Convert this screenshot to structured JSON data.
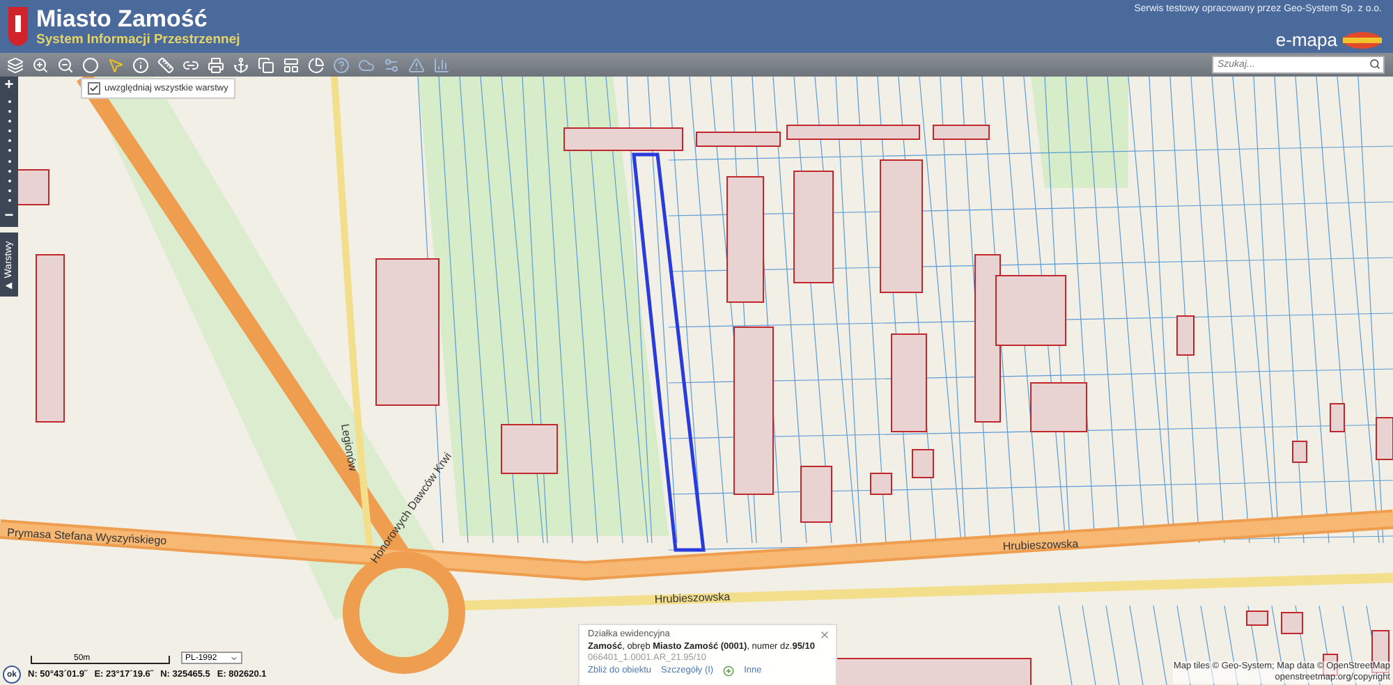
{
  "header": {
    "title": "Miasto Zamość",
    "subtitle": "System Informacji Przestrzennej",
    "credit": "Serwis testowy opracowany przez Geo-System Sp. z o.o.",
    "brand": "e-mapa"
  },
  "toolbar": {
    "tools": [
      {
        "kind": "layers",
        "disabled": false
      },
      {
        "kind": "zoom-in",
        "disabled": false
      },
      {
        "kind": "zoom-out",
        "disabled": false
      },
      {
        "kind": "extent",
        "disabled": false
      },
      {
        "kind": "select",
        "disabled": false
      },
      {
        "kind": "info",
        "disabled": false
      },
      {
        "kind": "measure",
        "disabled": false
      },
      {
        "kind": "link",
        "disabled": false
      },
      {
        "kind": "print",
        "disabled": false
      },
      {
        "kind": "pin",
        "disabled": false
      },
      {
        "kind": "export",
        "disabled": false
      },
      {
        "kind": "layout",
        "disabled": false
      },
      {
        "kind": "shade",
        "disabled": false
      },
      {
        "kind": "help",
        "disabled": true
      },
      {
        "kind": "cloud",
        "disabled": true
      },
      {
        "kind": "settings",
        "disabled": true
      },
      {
        "kind": "warning",
        "disabled": true
      },
      {
        "kind": "chart",
        "disabled": true
      }
    ],
    "search": {
      "placeholder": "Szukaj..."
    }
  },
  "zoom": {
    "plus": "+",
    "minus": "−"
  },
  "layers_tab": {
    "label": "Warstwy"
  },
  "layers_option": {
    "label": "uwzględniaj wszystkie warstwy",
    "checked": true
  },
  "map": {
    "streets": [
      {
        "name": "Prymasa Stefana Wyszyńskiego",
        "kind": "main"
      },
      {
        "name": "Hrubieszowska",
        "kind": "main"
      },
      {
        "name": "Hrubieszowska",
        "kind": "side"
      },
      {
        "name": "Legionów",
        "kind": "vertical"
      },
      {
        "name": "Honorowych Dawców Krwi",
        "kind": "ring"
      }
    ]
  },
  "popup": {
    "title": "Działka ewidencyjna",
    "description": "**Zamość**, obręb **Miasto Zamość (0001)**, numer dz.**95/10**",
    "id": "066401_1.0001.AR_21.95/10",
    "links": [
      "Zbliż do obiektu",
      "Szczegóły (I)"
    ],
    "more": "Inne"
  },
  "coordinates": {
    "scale": "50m",
    "crs": "PL-1992",
    "ok": "ok",
    "values": [
      "N: 50°43´01.9˝",
      "E: 23°17´19.6˝",
      "N: 325465.5",
      "E: 802620.1"
    ]
  },
  "attribution": "Map tiles © Geo-System; Map data © OpenStreetMap\nopenstreetmap.org/copyright"
}
